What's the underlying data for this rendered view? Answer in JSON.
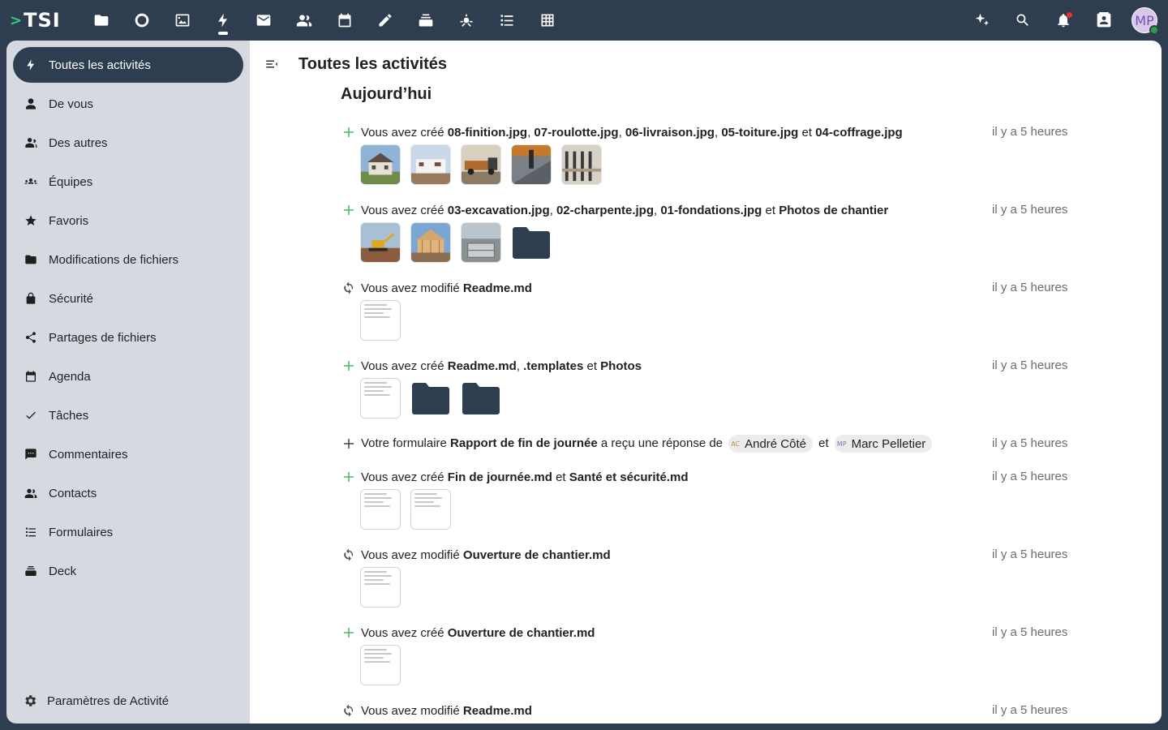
{
  "logo": {
    "chevron": ">",
    "text": "TSI"
  },
  "topnav": {
    "apps": [
      {
        "icon": "folder-icon",
        "label": "Fichiers"
      },
      {
        "icon": "circle-icon",
        "label": "Tableau de bord"
      },
      {
        "icon": "image-icon",
        "label": "Photos"
      },
      {
        "icon": "bolt-icon",
        "label": "Activité",
        "active": true
      },
      {
        "icon": "mail-icon",
        "label": "Courriel"
      },
      {
        "icon": "contacts-icon",
        "label": "Contacts"
      },
      {
        "icon": "calendar-icon",
        "label": "Agenda"
      },
      {
        "icon": "pencil-icon",
        "label": "Notes"
      },
      {
        "icon": "deck-icon",
        "label": "Deck"
      },
      {
        "icon": "assistant-icon",
        "label": "Assistant"
      },
      {
        "icon": "list-icon",
        "label": "Formulaires"
      },
      {
        "icon": "table-icon",
        "label": "Tables"
      }
    ],
    "right": [
      "sparkle-icon",
      "search-icon",
      "bell-icon",
      "contact-card-icon"
    ],
    "avatar_initials": "MP"
  },
  "sidebar": {
    "items": [
      {
        "label": "Toutes les activités",
        "icon": "bolt-icon",
        "active": true
      },
      {
        "label": "De vous",
        "icon": "user-icon"
      },
      {
        "label": "Des autres",
        "icon": "users-icon"
      },
      {
        "label": "Équipes",
        "icon": "team-icon"
      },
      {
        "label": "Favoris",
        "icon": "star-icon"
      },
      {
        "label": "Modifications de fichiers",
        "icon": "folder-icon"
      },
      {
        "label": "Sécurité",
        "icon": "lock-icon"
      },
      {
        "label": "Partages de fichiers",
        "icon": "share-icon"
      },
      {
        "label": "Agenda",
        "icon": "calendar-icon"
      },
      {
        "label": "Tâches",
        "icon": "check-icon"
      },
      {
        "label": "Commentaires",
        "icon": "comment-icon"
      },
      {
        "label": "Contacts",
        "icon": "contacts-icon"
      },
      {
        "label": "Formulaires",
        "icon": "list-icon"
      },
      {
        "label": "Deck",
        "icon": "deck-icon"
      }
    ],
    "settings_label": "Paramètres de Activité"
  },
  "main": {
    "title": "Toutes les activités",
    "section": "Aujourd’hui",
    "activities": [
      {
        "type": "created",
        "prefix": "Vous avez créé ",
        "parts": [
          {
            "b": "08-finition.jpg"
          },
          {
            "t": ", "
          },
          {
            "b": "07-roulotte.jpg"
          },
          {
            "t": ", "
          },
          {
            "b": "06-livraison.jpg"
          },
          {
            "t": ", "
          },
          {
            "b": "05-toiture.jpg"
          },
          {
            "t": " et "
          },
          {
            "b": "04-coffrage.jpg"
          }
        ],
        "time": "il y a 5 heures",
        "previews": [
          "house",
          "trailer",
          "truck",
          "roof",
          "formwork"
        ]
      },
      {
        "type": "created",
        "prefix": "Vous avez créé ",
        "parts": [
          {
            "b": "03-excavation.jpg"
          },
          {
            "t": ", "
          },
          {
            "b": "02-charpente.jpg"
          },
          {
            "t": ", "
          },
          {
            "b": "01-fondations.jpg"
          },
          {
            "t": " et "
          },
          {
            "b": "Photos de chantier"
          }
        ],
        "time": "il y a 5 heures",
        "previews": [
          "excavator",
          "frame",
          "foundation",
          "folder"
        ]
      },
      {
        "type": "modified",
        "prefix": "Vous avez modifié ",
        "parts": [
          {
            "b": "Readme.md"
          }
        ],
        "time": "il y a 5 heures",
        "previews": [
          "doc"
        ]
      },
      {
        "type": "created",
        "prefix": "Vous avez créé ",
        "parts": [
          {
            "b": "Readme.md"
          },
          {
            "t": ", "
          },
          {
            "b": ".templates"
          },
          {
            "t": " et "
          },
          {
            "b": "Photos"
          }
        ],
        "time": "il y a 5 heures",
        "previews": [
          "doc",
          "folder",
          "folder"
        ]
      },
      {
        "type": "form",
        "prefix": "Votre formulaire ",
        "parts": [
          {
            "b": "Rapport de fin de journée"
          },
          {
            "t": " a reçu une réponse de "
          }
        ],
        "chips": [
          {
            "initials": "AC",
            "name": "André Côté"
          },
          {
            "initials": "MP",
            "name": "Marc Pelletier"
          }
        ],
        "chip_sep": "et",
        "time": "il y a 5 heures",
        "previews": []
      },
      {
        "type": "created",
        "prefix": "Vous avez créé ",
        "parts": [
          {
            "b": "Fin de journée.md"
          },
          {
            "t": " et "
          },
          {
            "b": "Santé et sécurité.md"
          }
        ],
        "time": "il y a 5 heures",
        "previews": [
          "doc",
          "doc"
        ]
      },
      {
        "type": "modified",
        "prefix": "Vous avez modifié ",
        "parts": [
          {
            "b": "Ouverture de chantier.md"
          }
        ],
        "time": "il y a 5 heures",
        "previews": [
          "doc"
        ]
      },
      {
        "type": "created",
        "prefix": "Vous avez créé ",
        "parts": [
          {
            "b": "Ouverture de chantier.md"
          }
        ],
        "time": "il y a 5 heures",
        "previews": [
          "doc"
        ]
      },
      {
        "type": "modified",
        "prefix": "Vous avez modifié ",
        "parts": [
          {
            "b": "Readme.md"
          }
        ],
        "time": "il y a 5 heures",
        "previews": []
      }
    ]
  },
  "colors": {
    "header": "#2e3e50",
    "sidebar": "#d6dae0",
    "created": "#46ba61",
    "accent_active": "#2e3e50"
  }
}
